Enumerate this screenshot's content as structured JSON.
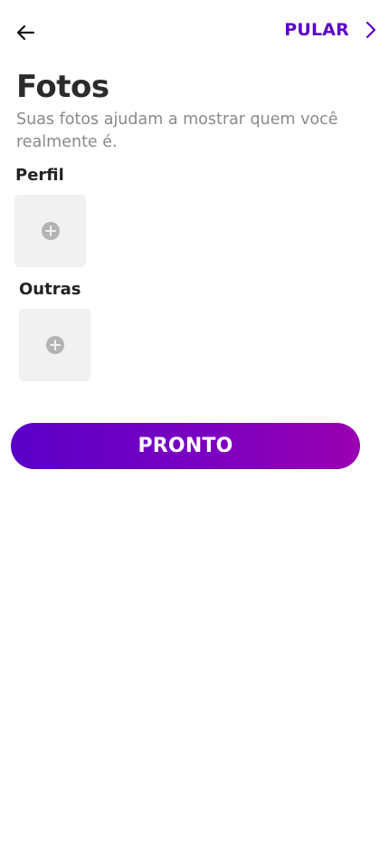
{
  "header": {
    "back_icon": "arrow-left-icon",
    "skip_label": "PULAR",
    "skip_icon": "chevron-right-icon"
  },
  "page": {
    "title": "Fotos",
    "subtitle": "Suas fotos ajudam a mostrar quem você realmente é."
  },
  "sections": {
    "profile": {
      "label": "Perfil",
      "slot_icon": "add-circle-icon"
    },
    "others": {
      "label": "Outras",
      "slot_icon": "add-circle-icon"
    }
  },
  "actions": {
    "done_label": "PRONTO"
  },
  "colors": {
    "accent": "#5b00c9",
    "gradient_start": "#5a00c8",
    "gradient_end": "#9a00b0",
    "slot_background": "#f1f1f1",
    "title_text": "#2b2b2b",
    "subtitle_text": "#8a8a8a"
  }
}
